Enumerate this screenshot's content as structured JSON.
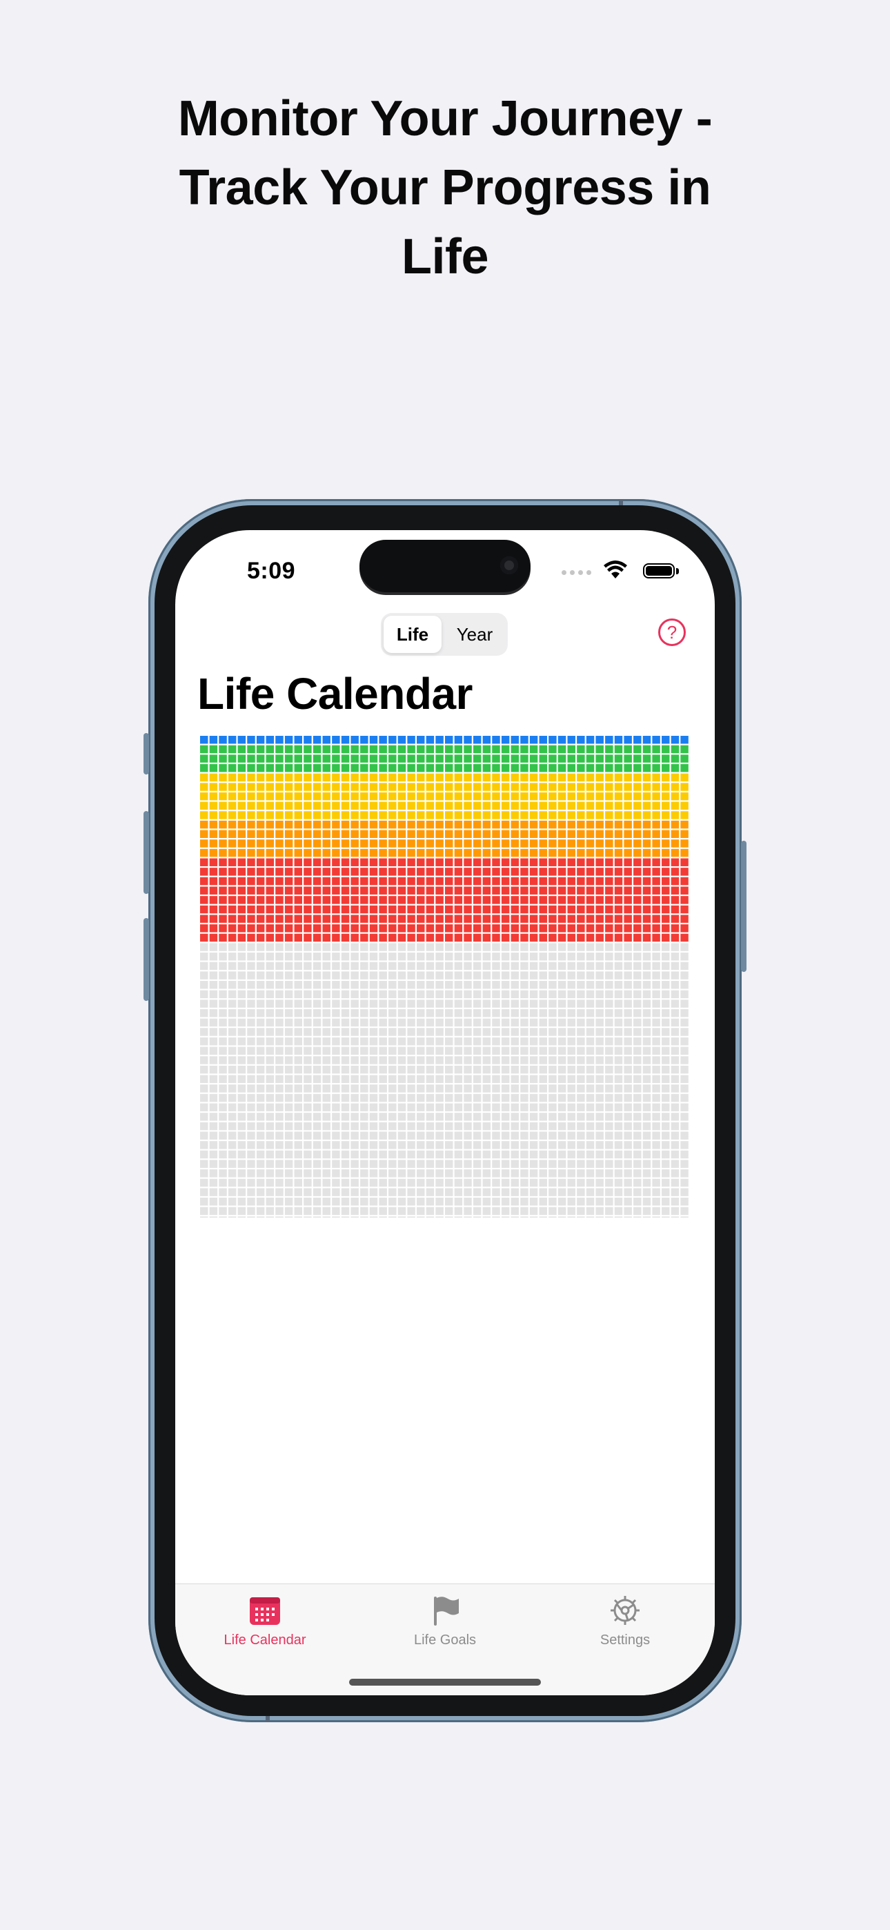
{
  "headline": {
    "line1": "Monitor Your Journey -",
    "line2": "Track Your Progress in",
    "line3": "Life"
  },
  "status_bar": {
    "time": "5:09"
  },
  "segmented_control": {
    "options": [
      "Life",
      "Year"
    ],
    "selected": "Life"
  },
  "help_button": {
    "glyph": "?"
  },
  "page_title": "Life Calendar",
  "calendar_grid": {
    "columns": 52,
    "bands": [
      {
        "rows": 1,
        "color": "#1a7ef0"
      },
      {
        "rows": 3,
        "color": "#34c34a"
      },
      {
        "rows": 5,
        "color": "#fccb02"
      },
      {
        "rows": 4,
        "color": "#ff9a06"
      },
      {
        "rows": 9,
        "color": "#f23b35"
      },
      {
        "rows": 30,
        "color": "#e3e3e3"
      }
    ]
  },
  "tab_bar": {
    "tabs": [
      {
        "label": "Life Calendar",
        "icon": "calendar-icon",
        "active": true
      },
      {
        "label": "Life Goals",
        "icon": "flag-icon",
        "active": false
      },
      {
        "label": "Settings",
        "icon": "gear-icon",
        "active": false
      }
    ]
  },
  "colors": {
    "accent": "#e8325d",
    "inactive_tab": "#8c8c8c"
  }
}
